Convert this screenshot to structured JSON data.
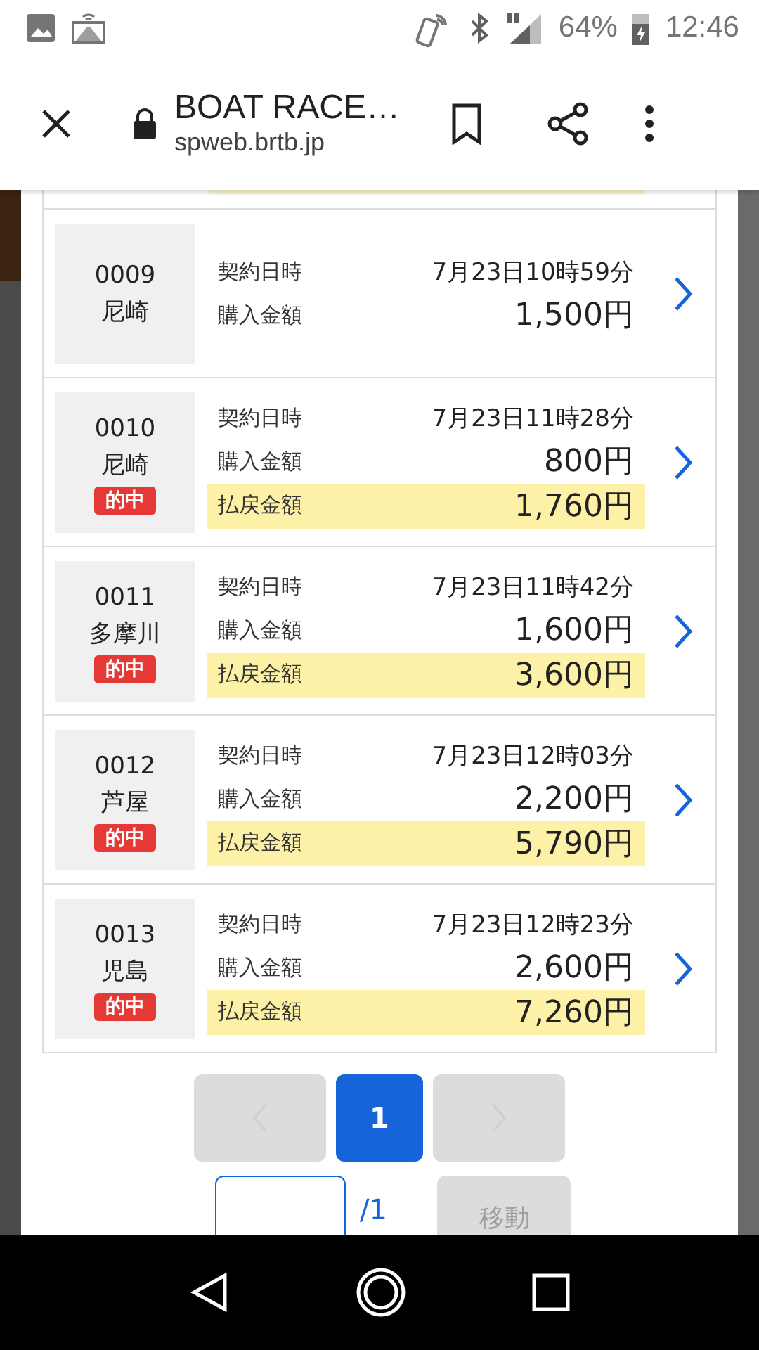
{
  "status_bar": {
    "battery": "64%",
    "time": "12:46"
  },
  "browser": {
    "title": "BOAT RACE…",
    "url": "spweb.brtb.jp"
  },
  "records": [
    {
      "number": "0009",
      "venue": "尼崎",
      "hit": false,
      "date_label": "契約日時",
      "date": "7月23日10時59分",
      "purchase_label": "購入金額",
      "purchase": "1,500円"
    },
    {
      "number": "0010",
      "venue": "尼崎",
      "hit": true,
      "hit_label": "的中",
      "date_label": "契約日時",
      "date": "7月23日11時28分",
      "purchase_label": "購入金額",
      "purchase": "800円",
      "payout_label": "払戻金額",
      "payout": "1,760円"
    },
    {
      "number": "0011",
      "venue": "多摩川",
      "hit": true,
      "hit_label": "的中",
      "date_label": "契約日時",
      "date": "7月23日11時42分",
      "purchase_label": "購入金額",
      "purchase": "1,600円",
      "payout_label": "払戻金額",
      "payout": "3,600円"
    },
    {
      "number": "0012",
      "venue": "芦屋",
      "hit": true,
      "hit_label": "的中",
      "date_label": "契約日時",
      "date": "7月23日12時03分",
      "purchase_label": "購入金額",
      "purchase": "2,200円",
      "payout_label": "払戻金額",
      "payout": "5,790円"
    },
    {
      "number": "0013",
      "venue": "児島",
      "hit": true,
      "hit_label": "的中",
      "date_label": "契約日時",
      "date": "7月23日12時23分",
      "purchase_label": "購入金額",
      "purchase": "2,600円",
      "payout_label": "払戻金額",
      "payout": "7,260円"
    }
  ],
  "pagination": {
    "pages": [
      {
        "label": "1",
        "selected": true
      }
    ],
    "prev_disabled": true,
    "next_disabled": true,
    "total": "/1",
    "jump_button": "移動"
  }
}
